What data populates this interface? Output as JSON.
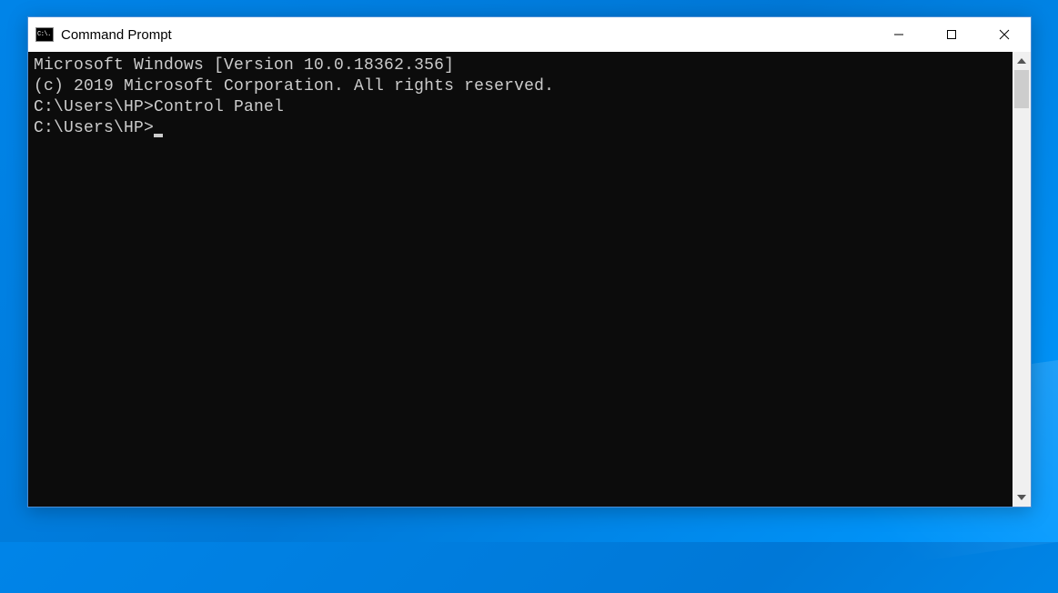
{
  "window": {
    "title": "Command Prompt",
    "icon_text": "C:\\."
  },
  "terminal": {
    "line1": "Microsoft Windows [Version 10.0.18362.356]",
    "line2": "(c) 2019 Microsoft Corporation. All rights reserved.",
    "blank1": "",
    "prompt1_path": "C:\\Users\\HP>",
    "prompt1_cmd": "Control Panel",
    "blank2": "",
    "prompt2_path": "C:\\Users\\HP>"
  }
}
